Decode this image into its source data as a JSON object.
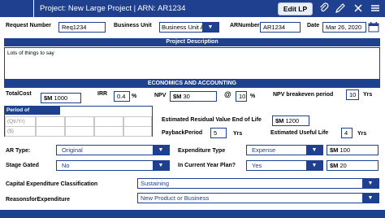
{
  "header": {
    "title": "Project: New Large Project | ARN: AR1234",
    "edit_button": "Edit LP"
  },
  "fields": {
    "request_number_label": "Request Number",
    "request_number_value": "Req1234",
    "business_unit_label": "Business Unit",
    "business_unit_value": "Business Unit A",
    "ar_number_label": "ARNumber",
    "ar_number_value": "AR1234",
    "date_label": "Date",
    "date_value": "Mar 26, 2020"
  },
  "sections": {
    "description_title": "Project Description",
    "economics_title": "ECONOMICS AND ACCOUNTING"
  },
  "description": {
    "text": "Lots of things to say"
  },
  "economics": {
    "total_cost_label": "TotalCost",
    "total_cost_prefix": "$M",
    "total_cost_value": "1000",
    "irr_label": "IRR",
    "irr_value": "0.4",
    "irr_unit": "%",
    "npv_label": "NPV",
    "npv_prefix": "$M",
    "npv_value": "30",
    "at_symbol": "@",
    "npv_rate_value": "10",
    "npv_rate_unit": "%",
    "npv_breakeven_label": "NPV breakeven period",
    "npv_breakeven_value": "10",
    "npv_breakeven_unit": "Yrs",
    "period_expenditures_label": "Period of Expenditures",
    "period_placeholder_1": "(Qtr/Yr)",
    "period_placeholder_2": "($)",
    "residual_value_label": "Estimated Residual Value End of Life",
    "residual_value_prefix": "$M",
    "residual_value_value": "1200",
    "payback_label": "PaybackPeriod",
    "payback_value": "5",
    "payback_unit": "Yrs",
    "useful_life_label": "Estimated Useful Life",
    "useful_life_value": "4",
    "useful_life_unit": "Yrs",
    "ar_type_label": "AR Type:",
    "ar_type_value": "Original",
    "expenditure_type_label": "Expenditure Type",
    "expenditure_type_value": "Expense",
    "expenditure_amount_prefix": "$M",
    "expenditure_amount_value": "100",
    "stage_gated_label": "Stage Gated",
    "stage_gated_value": "No",
    "current_year_label": "In Current Year Plan?",
    "current_year_value": "Yes",
    "current_year_amount_prefix": "$M",
    "current_year_amount_value": "20",
    "capex_class_label": "Capital Expenditure Classification",
    "capex_class_value": "Sustaining",
    "reason_label": "ReasonsforExpenditure",
    "reason_value": "New Product or Business"
  },
  "icons": {
    "attach": "paperclip-icon",
    "edit": "pencil-icon",
    "close": "close-icon",
    "menu": "menu-icon"
  }
}
